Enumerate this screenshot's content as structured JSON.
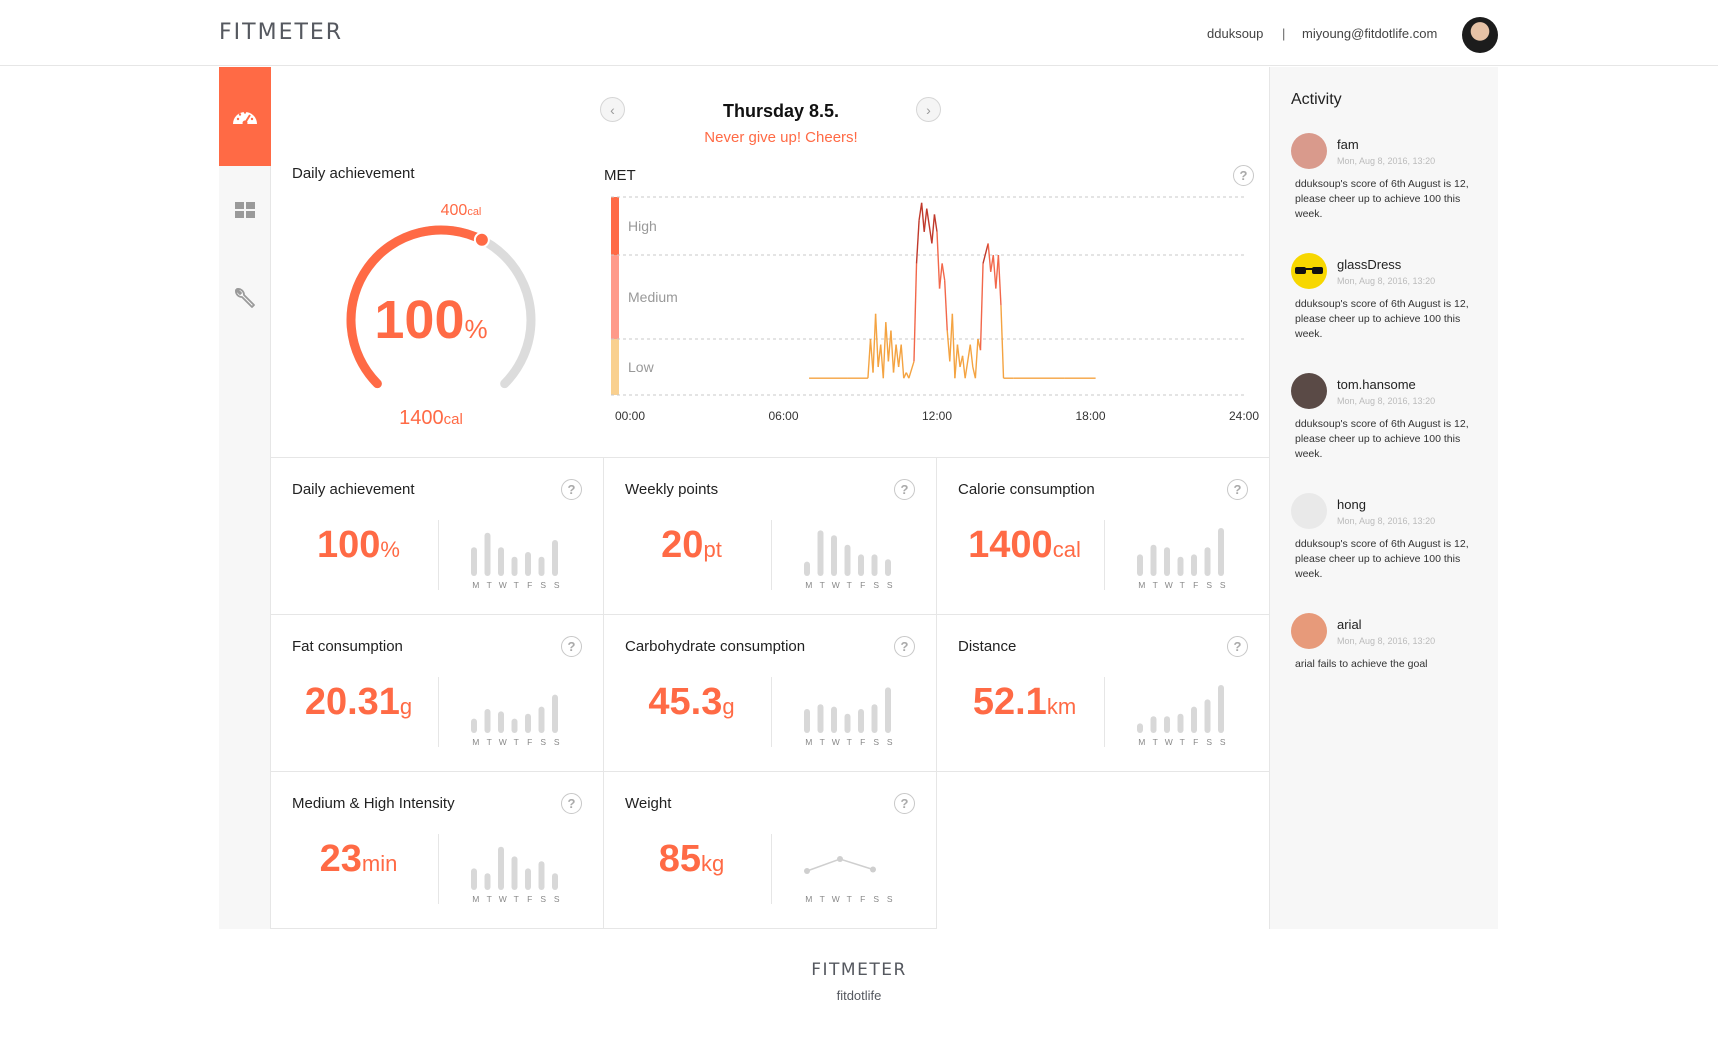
{
  "header": {
    "logo": "FITMETER",
    "username": "dduksoup",
    "separator": "|",
    "email": "miyoung@fitdotlife.com"
  },
  "sidebar": {
    "items": [
      {
        "icon": "dashboard-gauge-icon",
        "active": true
      },
      {
        "icon": "grid-icon",
        "active": false
      },
      {
        "icon": "wrench-icon",
        "active": false
      }
    ]
  },
  "date_nav": {
    "title": "Thursday 8.5.",
    "subtitle": "Never give up! Cheers!",
    "prev_icon": "chevron-left-icon",
    "next_icon": "chevron-right-icon"
  },
  "achievement": {
    "title": "Daily achievement",
    "percent": "100",
    "percent_unit": "%",
    "current": "400",
    "current_unit": "cal",
    "goal": "1400",
    "goal_unit": "cal",
    "progress_fraction": 0.6
  },
  "met": {
    "title": "MET",
    "levels": [
      "High",
      "Medium",
      "Low"
    ],
    "x_ticks": [
      "00:00",
      "06:00",
      "12:00",
      "18:00",
      "24:00"
    ],
    "colors": {
      "high": "#ff6a45",
      "medium": "#ff9a8a",
      "low": "#f9d08f"
    }
  },
  "chart_data": {
    "type": "line",
    "title": "MET",
    "x_label": "",
    "y_label": "",
    "x_range": [
      "00:00",
      "24:00"
    ],
    "y_categories": [
      "Low",
      "Medium",
      "High"
    ],
    "note_y": "level index 0=baseline, 1=Low top, 2=Medium top, 3=High top",
    "series": [
      {
        "values": [
          [
            7.0,
            0.3
          ],
          [
            8.5,
            0.3
          ],
          [
            9.3,
            0.3
          ],
          [
            9.4,
            1.0
          ],
          [
            9.5,
            0.4
          ],
          [
            9.6,
            1.3
          ],
          [
            9.7,
            0.5
          ],
          [
            9.8,
            0.9
          ],
          [
            9.9,
            0.3
          ],
          [
            10.0,
            1.2
          ],
          [
            10.1,
            0.6
          ],
          [
            10.2,
            1.1
          ],
          [
            10.3,
            0.4
          ],
          [
            10.4,
            0.9
          ],
          [
            10.5,
            0.5
          ],
          [
            10.6,
            0.9
          ],
          [
            10.7,
            0.3
          ],
          [
            10.8,
            0.4
          ],
          [
            10.9,
            0.3
          ],
          [
            11.1,
            0.6
          ],
          [
            11.2,
            1.9
          ],
          [
            11.3,
            2.6
          ],
          [
            11.4,
            2.9
          ],
          [
            11.5,
            2.4
          ],
          [
            11.6,
            2.8
          ],
          [
            11.7,
            2.5
          ],
          [
            11.8,
            2.2
          ],
          [
            11.9,
            2.7
          ],
          [
            12.0,
            2.4
          ],
          [
            12.1,
            1.6
          ],
          [
            12.2,
            1.9
          ],
          [
            12.3,
            1.7
          ],
          [
            12.4,
            1.1
          ],
          [
            12.5,
            0.6
          ],
          [
            12.6,
            1.3
          ],
          [
            12.7,
            0.3
          ],
          [
            12.8,
            0.9
          ],
          [
            12.9,
            0.5
          ],
          [
            13.0,
            0.7
          ],
          [
            13.1,
            0.3
          ],
          [
            13.3,
            0.9
          ],
          [
            13.4,
            0.5
          ],
          [
            13.5,
            0.3
          ],
          [
            13.6,
            1.0
          ],
          [
            13.7,
            0.8
          ],
          [
            13.8,
            1.9
          ],
          [
            14.0,
            2.2
          ],
          [
            14.1,
            1.8
          ],
          [
            14.2,
            2.0
          ],
          [
            14.3,
            1.6
          ],
          [
            14.4,
            2.0
          ],
          [
            14.5,
            1.4
          ],
          [
            14.6,
            0.3
          ],
          [
            15.0,
            0.3
          ],
          [
            17.0,
            0.3
          ],
          [
            18.2,
            0.3
          ]
        ]
      }
    ]
  },
  "cards": [
    {
      "title": "Daily achievement",
      "value": "100",
      "unit": "%",
      "kind": "bars",
      "bars": [
        0.6,
        0.9,
        0.6,
        0.4,
        0.5,
        0.4,
        0.75
      ]
    },
    {
      "title": "Weekly points",
      "value": "20",
      "unit": "pt",
      "kind": "bars",
      "bars": [
        0.3,
        0.95,
        0.85,
        0.65,
        0.45,
        0.45,
        0.35
      ]
    },
    {
      "title": "Calorie consumption",
      "value": "1400",
      "unit": "cal",
      "kind": "bars",
      "bars": [
        0.45,
        0.65,
        0.6,
        0.4,
        0.45,
        0.6,
        1.0
      ]
    },
    {
      "title": "Fat consumption",
      "value": "20.31",
      "unit": "g",
      "kind": "bars",
      "bars": [
        0.3,
        0.5,
        0.45,
        0.3,
        0.4,
        0.55,
        0.8
      ]
    },
    {
      "title": "Carbohydrate consumption",
      "value": "45.3",
      "unit": "g",
      "kind": "bars",
      "bars": [
        0.5,
        0.6,
        0.55,
        0.4,
        0.5,
        0.6,
        0.95
      ]
    },
    {
      "title": "Distance",
      "value": "52.1",
      "unit": "km",
      "kind": "bars",
      "bars": [
        0.2,
        0.35,
        0.35,
        0.4,
        0.55,
        0.7,
        1.0
      ]
    },
    {
      "title": "Medium & High Intensity",
      "value": "23",
      "unit": "min",
      "kind": "bars",
      "bars": [
        0.45,
        0.35,
        0.9,
        0.7,
        0.45,
        0.6,
        0.35
      ]
    },
    {
      "title": "Weight",
      "value": "85",
      "unit": "kg",
      "kind": "line",
      "line": [
        0.3,
        0.7,
        0.35
      ]
    }
  ],
  "days": [
    "M",
    "T",
    "W",
    "T",
    "F",
    "S",
    "S"
  ],
  "help_icon_label": "?",
  "activity": {
    "title": "Activity",
    "items": [
      {
        "name": "fam",
        "time": "Mon, Aug 8, 2016, 13:20",
        "msg": "dduksoup's score of 6th August is 12, please cheer up to achieve 100 this week.",
        "avatar_color": "#d99a8c"
      },
      {
        "name": "glassDress",
        "time": "Mon, Aug 8, 2016, 13:20",
        "msg": "dduksoup's score of 6th August is 12, please cheer up to achieve 100 this week.",
        "avatar_color": "#f7d700"
      },
      {
        "name": "tom.hansome",
        "time": "Mon, Aug 8, 2016, 13:20",
        "msg": "dduksoup's score of 6th August is 12, please cheer up to achieve 100 this week.",
        "avatar_color": "#5a4a46"
      },
      {
        "name": "hong",
        "time": "Mon, Aug 8, 2016, 13:20",
        "msg": "dduksoup's score of 6th August is 12, please cheer up to achieve 100 this week.",
        "avatar_color": "#e9e9e9"
      },
      {
        "name": "arial",
        "time": "Mon, Aug 8, 2016, 13:20",
        "msg": "arial fails to achieve the goal",
        "avatar_color": "#e79a7a"
      }
    ]
  },
  "footer": {
    "logo": "FITMETER",
    "sub": "fitdotlife"
  }
}
